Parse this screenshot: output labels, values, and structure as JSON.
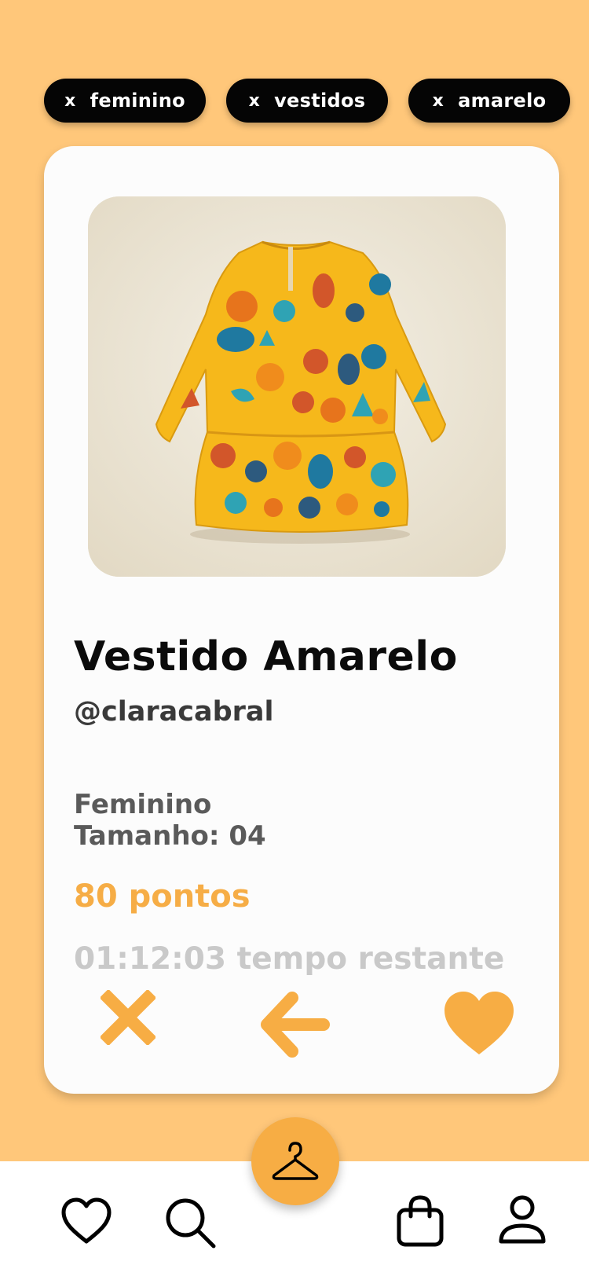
{
  "filters": [
    {
      "remove_glyph": "x",
      "label": "feminino"
    },
    {
      "remove_glyph": "x",
      "label": "vestidos"
    },
    {
      "remove_glyph": "x",
      "label": "amarelo"
    }
  ],
  "item": {
    "title": "Vestido Amarelo",
    "user": "@claracabral",
    "category": "Feminino",
    "size": "Tamanho: 04",
    "points": "80 pontos",
    "time_left": "01:12:03 tempo restante",
    "image_subject": "yellow printed long-sleeve dress"
  },
  "actions": [
    {
      "name": "reject",
      "icon": "close-icon"
    },
    {
      "name": "back",
      "icon": "arrow-left-icon"
    },
    {
      "name": "like",
      "icon": "heart-icon"
    }
  ],
  "nav": [
    {
      "name": "favorites",
      "icon": "heart-outline-icon"
    },
    {
      "name": "search",
      "icon": "search-icon"
    },
    {
      "name": "closet",
      "icon": "hanger-icon"
    },
    {
      "name": "bag",
      "icon": "shopping-bag-icon"
    },
    {
      "name": "profile",
      "icon": "user-icon"
    }
  ],
  "colors": {
    "background": "#ffc77a",
    "accent": "#f7ad44",
    "chip": "#050505",
    "card": "#fcfcfc"
  }
}
